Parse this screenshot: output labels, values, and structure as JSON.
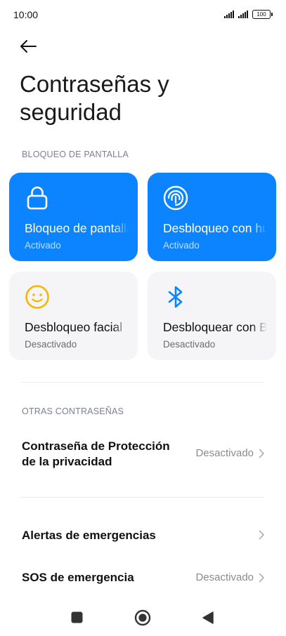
{
  "status_bar": {
    "time": "10:00",
    "battery": "100"
  },
  "header": {
    "title": "Contraseñas y seguridad"
  },
  "screen_lock": {
    "section_label": "BLOQUEO DE PANTALLA",
    "cards": [
      {
        "title": "Bloqueo de pantalla",
        "status": "Activado",
        "icon": "lock-icon",
        "active": true
      },
      {
        "title": "Desbloqueo con huella",
        "status": "Activado",
        "icon": "fingerprint-icon",
        "active": true
      },
      {
        "title": "Desbloqueo facial",
        "status": "Desactivado",
        "icon": "face-icon",
        "active": false
      },
      {
        "title": "Desbloquear con Bluetooth",
        "status": "Desactivado",
        "icon": "bluetooth-icon",
        "active": false
      }
    ]
  },
  "other_passwords": {
    "section_label": "OTRAS CONTRASEÑAS",
    "privacy_password": {
      "label": "Contraseña de Protección de la privacidad",
      "value": "Desactivado"
    }
  },
  "emergency": {
    "alerts": {
      "label": "Alertas de emergencias"
    },
    "sos": {
      "label": "SOS de emergencia",
      "value": "Desactivado"
    }
  },
  "colors": {
    "accent": "#0d84ff",
    "card_gray": "#f5f5f7",
    "face_icon": "#f5b800",
    "section_text": "#7b7e9e"
  },
  "nav": {
    "icons": [
      "square-icon",
      "home-circle-icon",
      "back-triangle-icon"
    ]
  }
}
